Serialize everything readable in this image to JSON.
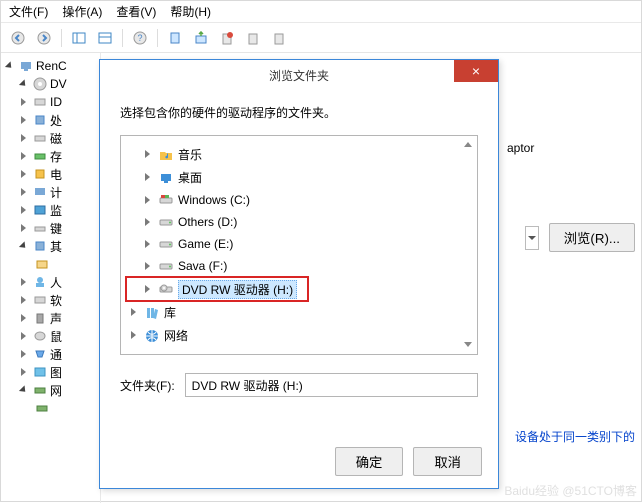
{
  "menu": {
    "file": "文件(F)",
    "action": "操作(A)",
    "view": "查看(V)",
    "help": "帮助(H)"
  },
  "background": {
    "root_label": "RenC",
    "dvd": "DV",
    "items": [
      "ID",
      "处",
      "磁",
      "存",
      "电",
      "计",
      "监",
      "键",
      "其",
      "人",
      "软",
      "声",
      "鼠",
      "通",
      "图",
      "网"
    ],
    "one_more": " ",
    "truncated_adapter": "aptor",
    "note": "设备处于同一类别下的",
    "browse_btn": "浏览(R)..."
  },
  "modal": {
    "title": "浏览文件夹",
    "close": "×",
    "prompt": "选择包含你的硬件的驱动程序的文件夹。",
    "folder_label": "文件夹(F):",
    "folder_value": "DVD RW 驱动器 (H:)",
    "ok": "确定",
    "cancel": "取消",
    "tree": {
      "music": "音乐",
      "desktop": "桌面",
      "win_c": "Windows (C:)",
      "others_d": "Others (D:)",
      "game_e": "Game (E:)",
      "sava_f": "Sava (F:)",
      "dvd_h": "DVD RW 驱动器 (H:)",
      "lib": "库",
      "net": "网络"
    }
  },
  "watermark": "Baidu经验  @51CTO博客"
}
